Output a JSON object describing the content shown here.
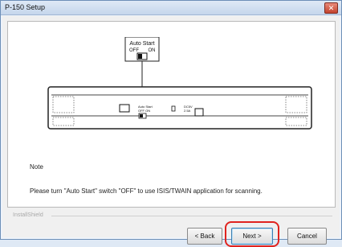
{
  "window": {
    "title": "P-150 Setup",
    "close_symbol": "✕"
  },
  "illustration": {
    "callout_title": "Auto Start",
    "callout_off": "OFF",
    "callout_on": "ON",
    "panel_label_1": "Auto Start",
    "panel_label_2": "OFF  ON",
    "panel_label_3": "DC5V",
    "panel_label_4": "2.5A"
  },
  "content": {
    "note": "Note",
    "message": "Please turn \"Auto Start\" switch \"OFF\" to use ISIS/TWAIN application for scanning."
  },
  "footer": {
    "brand": "InstallShield"
  },
  "buttons": {
    "back": "< Back",
    "next": "Next >",
    "cancel": "Cancel"
  }
}
